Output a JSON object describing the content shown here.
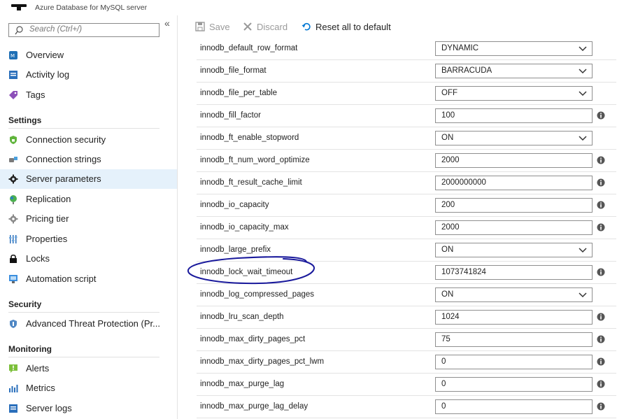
{
  "app": {
    "title": "Azure Database for MySQL server"
  },
  "search": {
    "placeholder": "Search (Ctrl+/)"
  },
  "sidebar": {
    "top_items": [
      {
        "label": "Overview"
      },
      {
        "label": "Activity log"
      },
      {
        "label": "Tags"
      }
    ],
    "sections": [
      {
        "title": "Settings",
        "items": [
          {
            "label": "Connection security"
          },
          {
            "label": "Connection strings"
          },
          {
            "label": "Server parameters",
            "active": true
          },
          {
            "label": "Replication"
          },
          {
            "label": "Pricing tier"
          },
          {
            "label": "Properties"
          },
          {
            "label": "Locks"
          },
          {
            "label": "Automation script"
          }
        ]
      },
      {
        "title": "Security",
        "items": [
          {
            "label": "Advanced Threat Protection (Pr..."
          }
        ]
      },
      {
        "title": "Monitoring",
        "items": [
          {
            "label": "Alerts"
          },
          {
            "label": "Metrics"
          },
          {
            "label": "Server logs"
          }
        ]
      }
    ]
  },
  "toolbar": {
    "save_label": "Save",
    "discard_label": "Discard",
    "reset_label": "Reset all to default"
  },
  "parameters": [
    {
      "name": "innodb_default_row_format",
      "value": "DYNAMIC",
      "kind": "select"
    },
    {
      "name": "innodb_file_format",
      "value": "BARRACUDA",
      "kind": "select"
    },
    {
      "name": "innodb_file_per_table",
      "value": "OFF",
      "kind": "select"
    },
    {
      "name": "innodb_fill_factor",
      "value": "100",
      "kind": "input"
    },
    {
      "name": "innodb_ft_enable_stopword",
      "value": "ON",
      "kind": "select"
    },
    {
      "name": "innodb_ft_num_word_optimize",
      "value": "2000",
      "kind": "input"
    },
    {
      "name": "innodb_ft_result_cache_limit",
      "value": "2000000000",
      "kind": "input"
    },
    {
      "name": "innodb_io_capacity",
      "value": "200",
      "kind": "input"
    },
    {
      "name": "innodb_io_capacity_max",
      "value": "2000",
      "kind": "input"
    },
    {
      "name": "innodb_large_prefix",
      "value": "ON",
      "kind": "select"
    },
    {
      "name": "innodb_lock_wait_timeout",
      "value": "1073741824",
      "kind": "input"
    },
    {
      "name": "innodb_log_compressed_pages",
      "value": "ON",
      "kind": "select"
    },
    {
      "name": "innodb_lru_scan_depth",
      "value": "1024",
      "kind": "input"
    },
    {
      "name": "innodb_max_dirty_pages_pct",
      "value": "75",
      "kind": "input"
    },
    {
      "name": "innodb_max_dirty_pages_pct_lwm",
      "value": "0",
      "kind": "input"
    },
    {
      "name": "innodb_max_purge_lag",
      "value": "0",
      "kind": "input"
    },
    {
      "name": "innodb_max_purge_lag_delay",
      "value": "0",
      "kind": "input"
    }
  ],
  "colors": {
    "accent": "#0078d4",
    "active_bg": "#e5f1fb",
    "annotation": "#1a1a9c"
  }
}
